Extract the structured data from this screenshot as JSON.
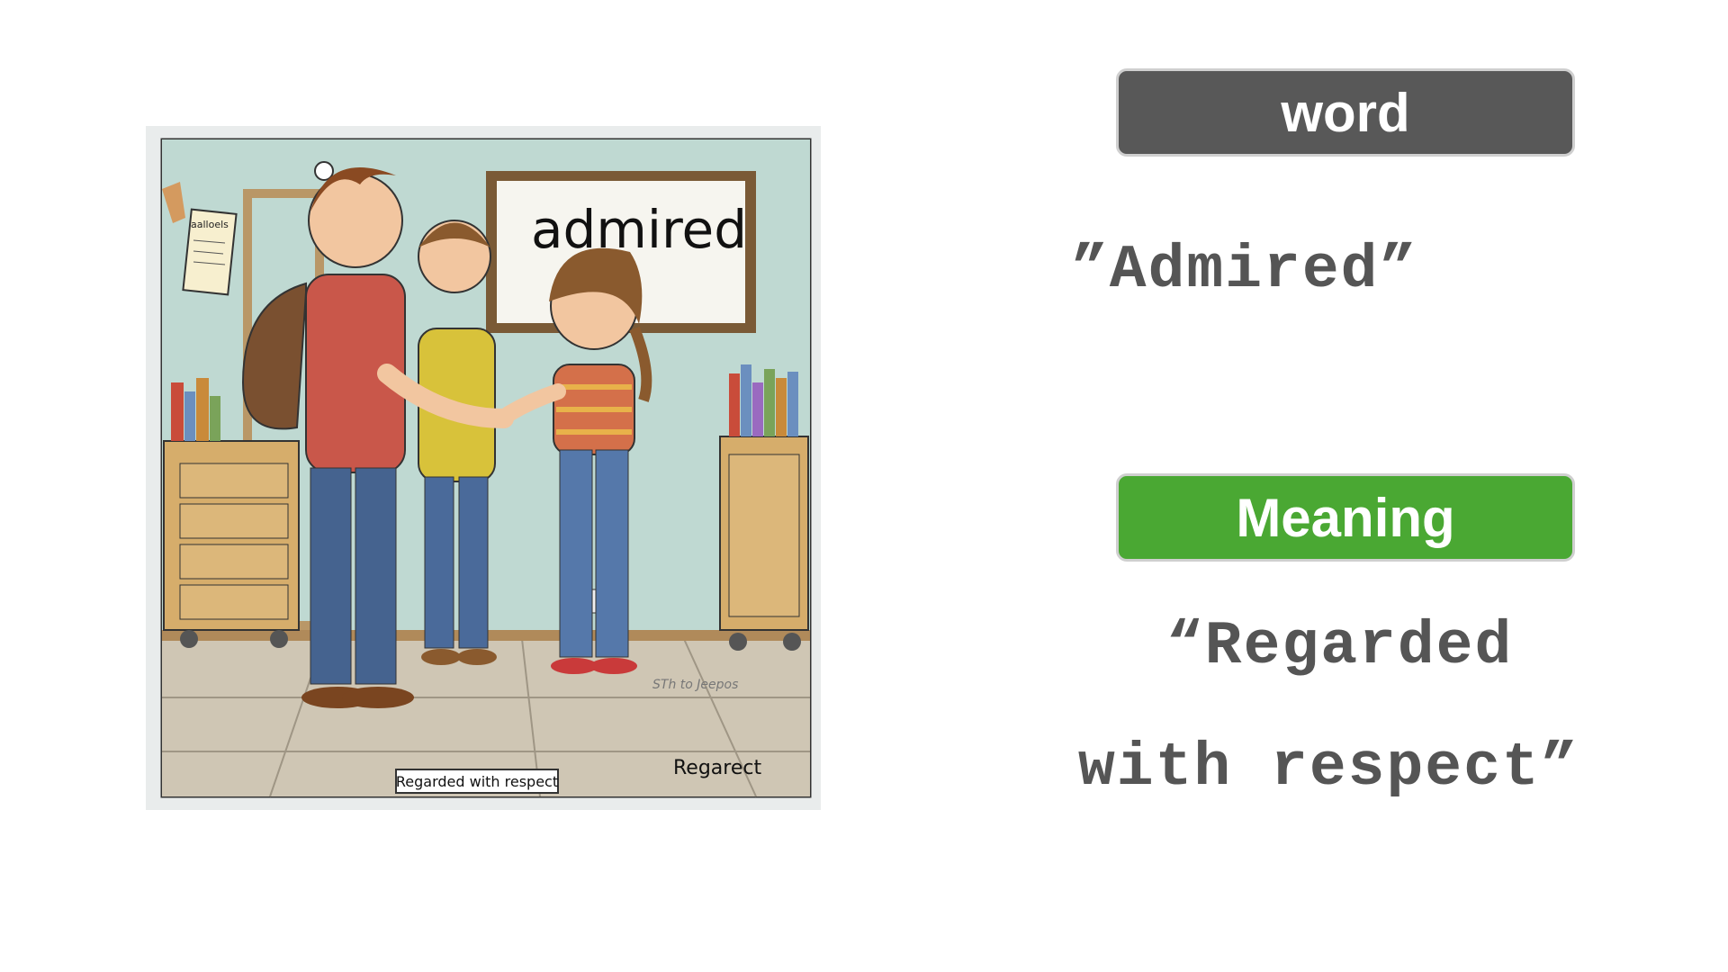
{
  "illustration": {
    "board_text": "admired",
    "note_text": "aalloels",
    "caption": "Regarded with respect",
    "corner_text": "Regarect",
    "floor_signature": "STh to Jeepos"
  },
  "word_label": "word",
  "word_value": "”Admired”",
  "meaning_label": "Meaning",
  "meaning_line1": "“Regarded",
  "meaning_line2": "with respect”",
  "colors": {
    "word_label_bg": "#585858",
    "meaning_label_bg": "#4aa833",
    "term_text": "#555555"
  }
}
